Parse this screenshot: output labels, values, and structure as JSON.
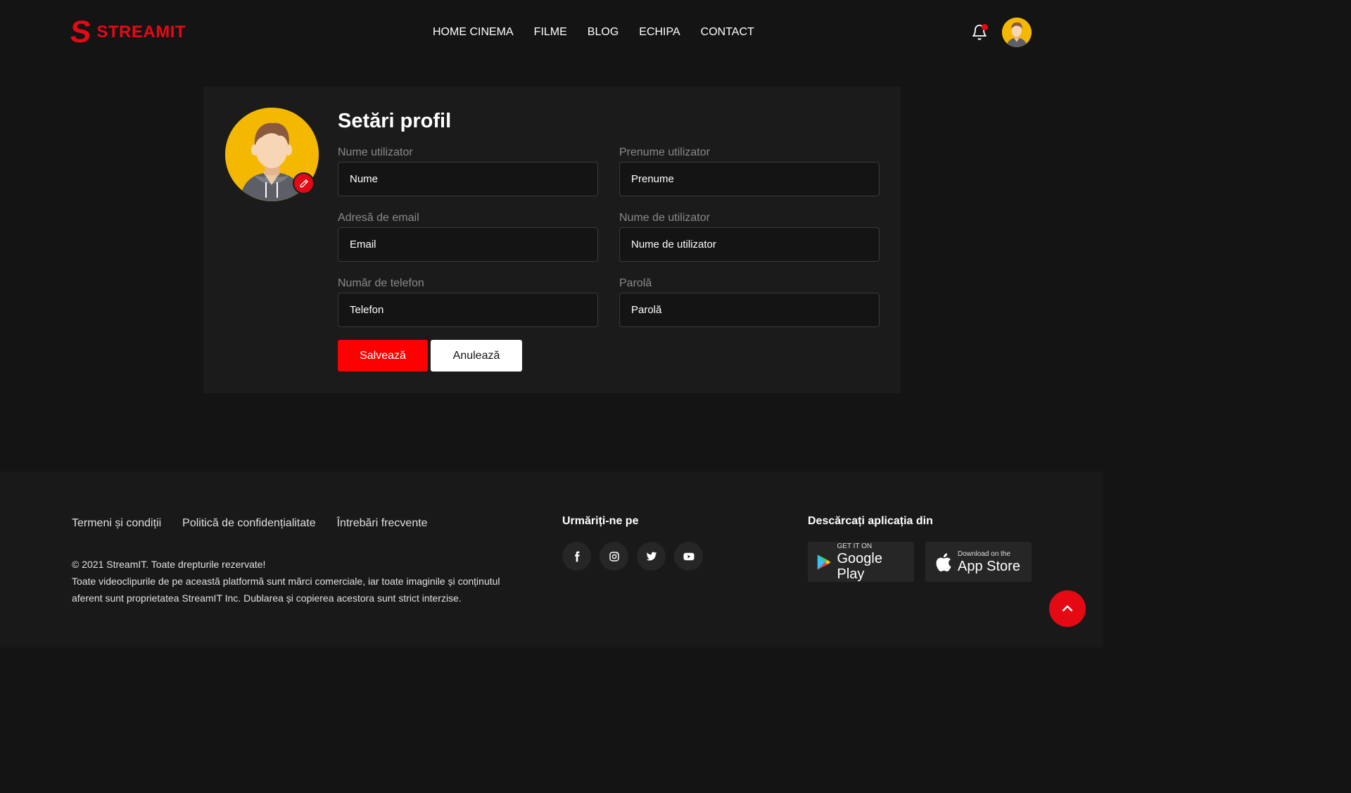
{
  "brand": {
    "logo_mark": "S",
    "name": "STREAMIT",
    "accent": "#e50914"
  },
  "nav": {
    "items": [
      {
        "label": "HOME CINEMA"
      },
      {
        "label": "FILME"
      },
      {
        "label": "BLOG"
      },
      {
        "label": "ECHIPA"
      },
      {
        "label": "CONTACT"
      }
    ]
  },
  "header": {
    "notification_icon": "bell-icon",
    "has_unread": true,
    "avatar_icon": "user-avatar"
  },
  "profile": {
    "title": "Setări profil",
    "edit_icon": "pencil-icon",
    "fields": {
      "first_name": {
        "label": "Nume utilizator",
        "placeholder": "Nume"
      },
      "last_name": {
        "label": "Prenume utilizator",
        "placeholder": "Prenume"
      },
      "email": {
        "label": "Adresă de email",
        "placeholder": "Email"
      },
      "username": {
        "label": "Nume de utilizator",
        "placeholder": "Nume de utilizator"
      },
      "phone": {
        "label": "Număr de telefon",
        "placeholder": "Telefon"
      },
      "password": {
        "label": "Parolă",
        "placeholder": "Parolă"
      }
    },
    "save_label": "Salvează",
    "cancel_label": "Anulează",
    "save_color": "#ff0000"
  },
  "footer": {
    "links": [
      {
        "label": "Termeni și condiții"
      },
      {
        "label": "Politică de confidențialitate"
      },
      {
        "label": "Întrebări frecvente"
      }
    ],
    "copyright": "© 2021 StreamIT. Toate drepturile rezervate!",
    "disclaimer": "Toate videoclipurile de pe această platformă sunt mărci comerciale, iar toate imaginile și conținutul aferent sunt proprietatea StreamIT Inc. Dublarea și copierea acestora sunt strict interzise.",
    "follow_title": "Urmăriți-ne pe",
    "socials": [
      "facebook-icon",
      "instagram-icon",
      "twitter-icon",
      "youtube-icon"
    ],
    "app_title": "Descărcați aplicația din",
    "google_play": {
      "small": "GET IT ON",
      "big": "Google Play"
    },
    "app_store": {
      "small": "Download on the",
      "big": "App Store"
    }
  },
  "scroll_top_icon": "chevron-up-icon"
}
